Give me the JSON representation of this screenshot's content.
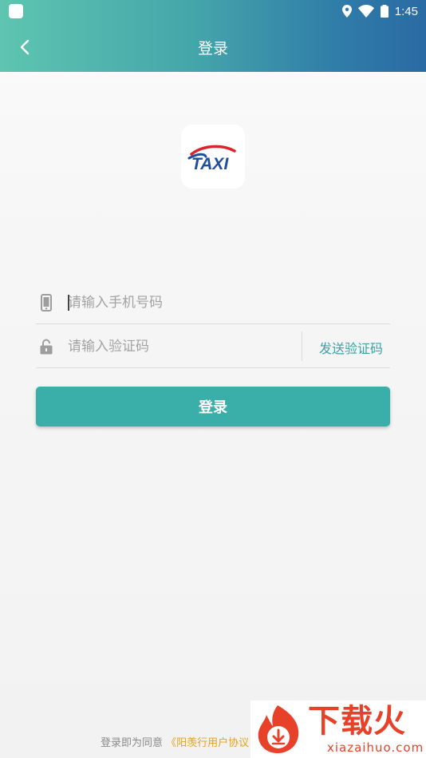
{
  "status_bar": {
    "time": "1:45",
    "icons": [
      "app-notification-icon",
      "location-icon",
      "wifi-icon",
      "battery-icon"
    ]
  },
  "header": {
    "title": "登录",
    "back_icon": "chevron-left-icon"
  },
  "logo": {
    "text": "TAXI",
    "icon": "taxi-logo"
  },
  "form": {
    "phone": {
      "icon": "phone-icon",
      "placeholder": "请输入手机号码",
      "value": ""
    },
    "code": {
      "icon": "lock-icon",
      "placeholder": "请输入验证码",
      "value": "",
      "send_label": "发送验证码"
    },
    "submit_label": "登录"
  },
  "footer": {
    "prefix": "登录即为同意",
    "agreement": "《阳羡行用户协议"
  },
  "watermark": {
    "cn": "下载火",
    "en": "xiazaihuo.com"
  },
  "colors": {
    "header_start": "#5ec5b0",
    "header_end": "#2a6aa4",
    "primary": "#3aafaa",
    "link": "#3aa3a6",
    "agreement": "#e3a21a",
    "watermark": "#e8412a"
  }
}
